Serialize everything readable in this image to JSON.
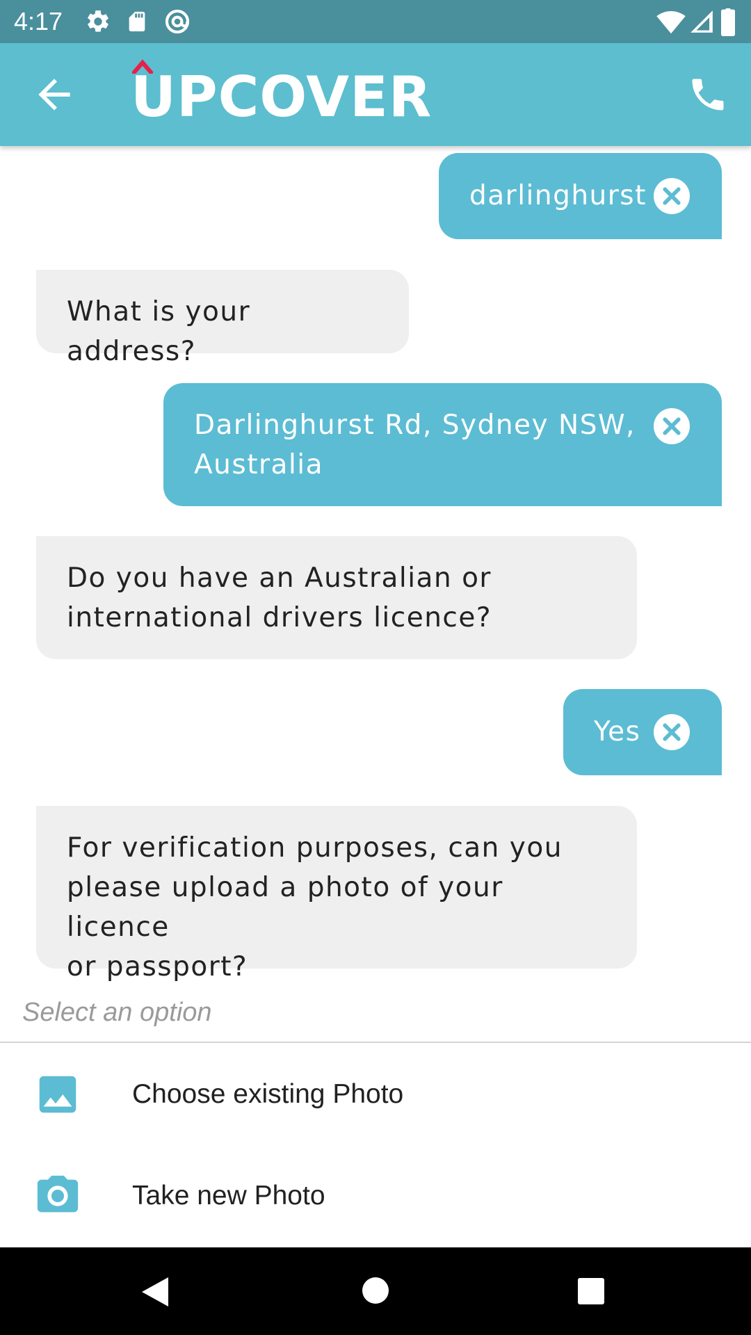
{
  "status_bar": {
    "time": "4:17",
    "icons": [
      "gear-icon",
      "sd-card-icon",
      "at-sign-icon",
      "wifi-icon",
      "signal-icon",
      "battery-icon"
    ]
  },
  "app_bar": {
    "logo_text": "UPCOVER",
    "back_icon": "arrow-left-icon",
    "call_icon": "phone-icon"
  },
  "chat": {
    "messages": [
      {
        "sender": "user",
        "text": "darlinghurst"
      },
      {
        "sender": "bot",
        "text": "What is your address?"
      },
      {
        "sender": "user",
        "line1": "Darlinghurst Rd, Sydney NSW,",
        "line2": "Australia"
      },
      {
        "sender": "bot",
        "line1": "Do you have an Australian or",
        "line2": "international drivers licence?"
      },
      {
        "sender": "user",
        "text": "Yes"
      },
      {
        "sender": "bot",
        "line1": "For verification purposes, can you",
        "line2": "please upload a photo of your licence",
        "line3": "or passport?"
      }
    ]
  },
  "options": {
    "hint": "Select an option",
    "items": [
      {
        "label": "Choose existing Photo",
        "icon": "image-icon"
      },
      {
        "label": "Take new Photo",
        "icon": "camera-icon"
      }
    ]
  },
  "colors": {
    "status_bar": "#4a8f9c",
    "app_bar": "#5cbece",
    "user_bubble": "#5cbcd3",
    "bot_bubble": "#efefef",
    "logo_accent": "#e8204a"
  },
  "nav_bar": {
    "icons": [
      "back-triangle-icon",
      "home-circle-icon",
      "recents-square-icon"
    ]
  }
}
